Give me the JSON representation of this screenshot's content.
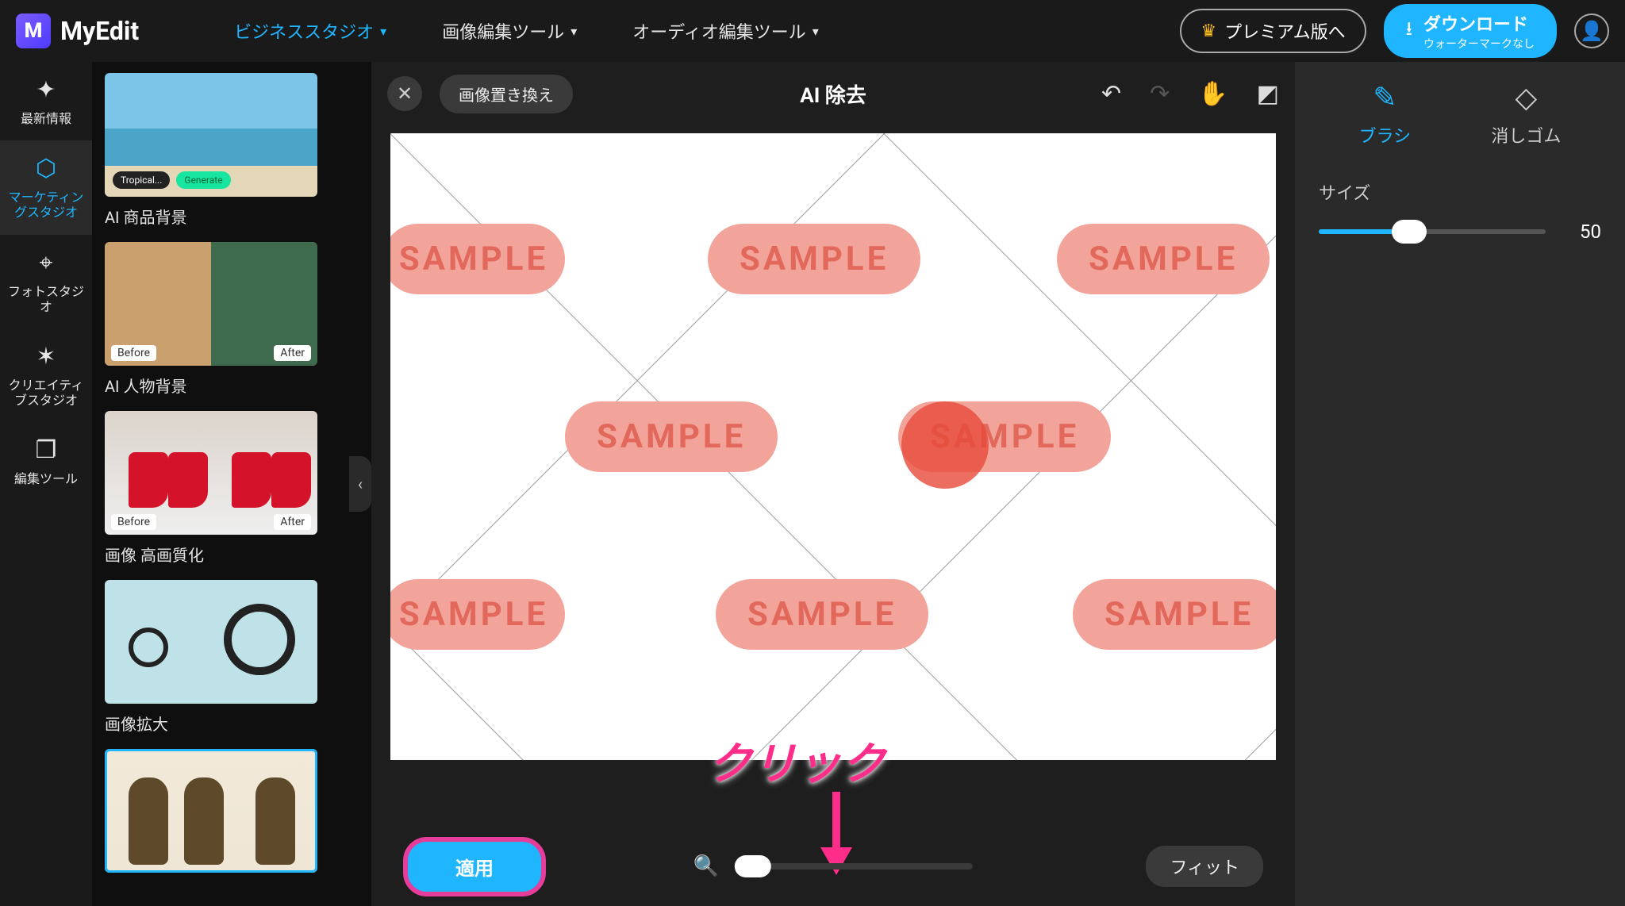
{
  "header": {
    "logo": "MyEdit",
    "nav": {
      "business": "ビジネススタジオ",
      "image": "画像編集ツール",
      "audio": "オーディオ編集ツール"
    },
    "premium": "プレミアム版へ",
    "download": {
      "main": "ダウンロード",
      "sub": "ウォーターマークなし"
    }
  },
  "rail": {
    "news": "最新情報",
    "marketing": "マーケティングスタジオ",
    "photo": "フォトスタジオ",
    "creative": "クリエイティブスタジオ",
    "edit": "編集ツール"
  },
  "thumbs": {
    "product_bg": "AI 商品背景",
    "person_bg": "AI 人物背景",
    "upscale": "画像 高画質化",
    "expand": "画像拡大",
    "before": "Before",
    "after": "After",
    "tropical": "Tropical...",
    "generate": "Generate"
  },
  "canvas": {
    "chip": "画像置き換え",
    "title": "AI 除去",
    "watermark": "SAMPLE",
    "apply": "適用",
    "fit": "フィット"
  },
  "right": {
    "brush": "ブラシ",
    "eraser": "消しゴム",
    "size_label": "サイズ",
    "size_value": "50"
  },
  "annotation": "クリック"
}
